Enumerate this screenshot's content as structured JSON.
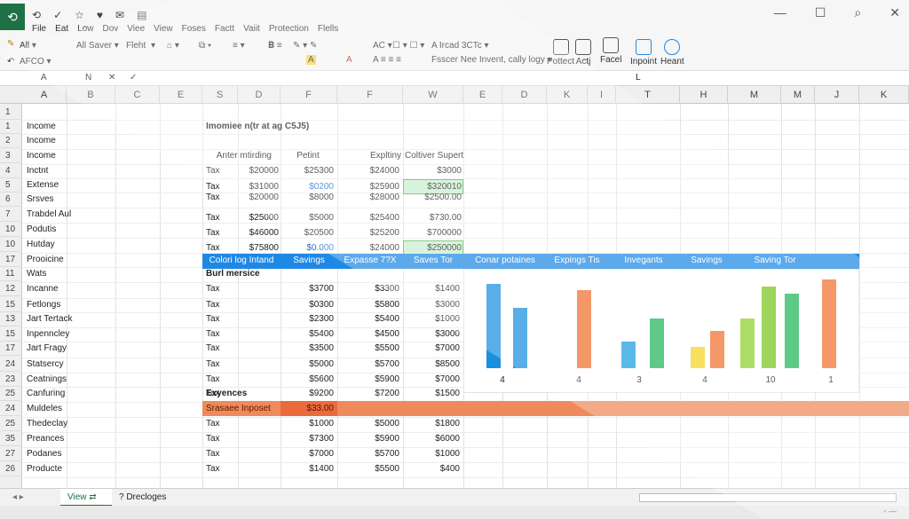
{
  "qat": [
    "⟲",
    "✓",
    "☆",
    "♥",
    "✉",
    "▤"
  ],
  "menu": [
    "File",
    "Eat",
    "Low",
    "Dov",
    "Viee",
    "View",
    "Foses",
    "Factt",
    "Vaiit",
    "Protection",
    "Flells"
  ],
  "ribbon": {
    "all1": "All ▾",
    "allsaver": "All Saver ▾",
    "font": "Fleht",
    "afco": "AFCO ▾",
    "ac": "AC ▾",
    "brand": "A Ircad 3CTc ▾",
    "format": "Fsscer Nee Invent, cally logy ▾",
    "btn_protect": "Pottect",
    "btn_acts": "Actj",
    "btn_facet": "Facel",
    "btn_import": "Inpoint",
    "btn_hear": "Heant"
  },
  "formula_bar": {
    "a": "A",
    "n": "N",
    "x": "✕",
    "check": "✓",
    "l": "L"
  },
  "col_headers": [
    "A",
    "B",
    "C",
    "E",
    "S",
    "D",
    "F",
    "F",
    "W",
    "E",
    "D",
    "K",
    "I",
    "T",
    "H",
    "M",
    "M",
    "J",
    "K"
  ],
  "row_numbers": [
    "1",
    "1",
    "2",
    "3",
    "4",
    "5",
    "6",
    "7",
    "10",
    "10",
    "17",
    "11",
    "12",
    "15",
    "13",
    "15",
    "17",
    "24",
    "23",
    "25",
    "24",
    "25",
    "35",
    "27",
    "26"
  ],
  "left_labels": [
    "",
    "Income",
    "Income",
    "Income",
    "Inctnt",
    "Extense",
    "Srsves",
    "Trabdel Aul",
    "Podutis",
    "Hutday",
    "Prooicine",
    "Wats",
    "Incanne",
    "Fetlongs",
    "Jart Tertack",
    "Inpenncley",
    "Jart Fragy",
    "Statsercy",
    "Ceatnings",
    "Canfuring",
    "Muldeles",
    "Thedeclay",
    "Preances",
    "Podanes",
    "Producte"
  ],
  "table_title": "Imomiee n(tr at ag C5J5)",
  "table_headers": [
    "Anter mtirding",
    "Petint",
    "Expltiny",
    "Coltiver Supert"
  ],
  "top_rows": [
    [
      "Tax",
      "$20000",
      "$25300",
      "$24000",
      "$3000"
    ],
    [
      "Tax",
      "$31000",
      "$0200",
      "$25900",
      "$320010"
    ],
    [
      "Tax",
      "$20000",
      "$8000",
      "$28000",
      "$2500.00"
    ],
    [
      "Tax",
      "$25000",
      "$5000",
      "$25400",
      "$730.00"
    ],
    [
      "Tax",
      "$46000",
      "$20500",
      "$25200",
      "$700000"
    ],
    [
      "Tax",
      "$75800",
      "$0.000",
      "$24000",
      "$250000"
    ]
  ],
  "blue_headers": [
    "Colori log Intand",
    "Savings",
    "Expasse 7?X",
    "Saves Tor",
    "Conar potaines",
    "Expings Tis",
    "Invegants",
    "Savings",
    "Saving Tor"
  ],
  "bott_merside": "Burl mersice",
  "bottom_rows": [
    [
      "Tax",
      "$3700",
      "$3300",
      "$1400"
    ],
    [
      "Tax",
      "$0300",
      "$5800",
      "$3000"
    ],
    [
      "Tax",
      "$2300",
      "$5400",
      "$1000"
    ],
    [
      "Tax",
      "$5400",
      "$4500",
      "$3000"
    ],
    [
      "Tax",
      "$3500",
      "$5500",
      "$7000"
    ],
    [
      "Tax",
      "$5000",
      "$5700",
      "$8500"
    ],
    [
      "Tax",
      "$5600",
      "$5900",
      "$7000"
    ],
    [
      "Tax",
      "$9200",
      "$7200",
      "$1500"
    ]
  ],
  "expences": "Exyences",
  "orange_label": "Srasaee Inposet",
  "orange_value": "$33.00",
  "lower_rows": [
    [
      "Tax",
      "$1000",
      "$5000",
      "$1800"
    ],
    [
      "Tax",
      "$7300",
      "$5900",
      "$6000"
    ],
    [
      "Tax",
      "$7000",
      "$5700",
      "$1000"
    ],
    [
      "Tax",
      "$1400",
      "$5500",
      "$400"
    ]
  ],
  "sheet_tabs": {
    "view": "View",
    "icon": "⇄",
    "sheet2": "? Drecloges"
  },
  "chart_data": {
    "type": "bar",
    "categories": [
      "4",
      "4",
      "3",
      "4",
      "10",
      "1"
    ],
    "bars": [
      [
        {
          "v": 0.95,
          "c": "#1a8fe0"
        },
        {
          "v": 0.68,
          "c": "#1a8fe0"
        }
      ],
      [
        {
          "v": 0.88,
          "c": "#f07030"
        }
      ],
      [
        {
          "v": 0.3,
          "c": "#1a9ee0"
        },
        {
          "v": 0.56,
          "c": "#22b55a"
        }
      ],
      [
        {
          "v": 0.24,
          "c": "#f5d520"
        },
        {
          "v": 0.42,
          "c": "#f07030"
        }
      ],
      [
        {
          "v": 0.56,
          "c": "#8ed02a"
        },
        {
          "v": 0.92,
          "c": "#79c51e"
        },
        {
          "v": 0.84,
          "c": "#22b55a"
        }
      ],
      [
        {
          "v": 1.0,
          "c": "#f07030"
        }
      ]
    ]
  }
}
